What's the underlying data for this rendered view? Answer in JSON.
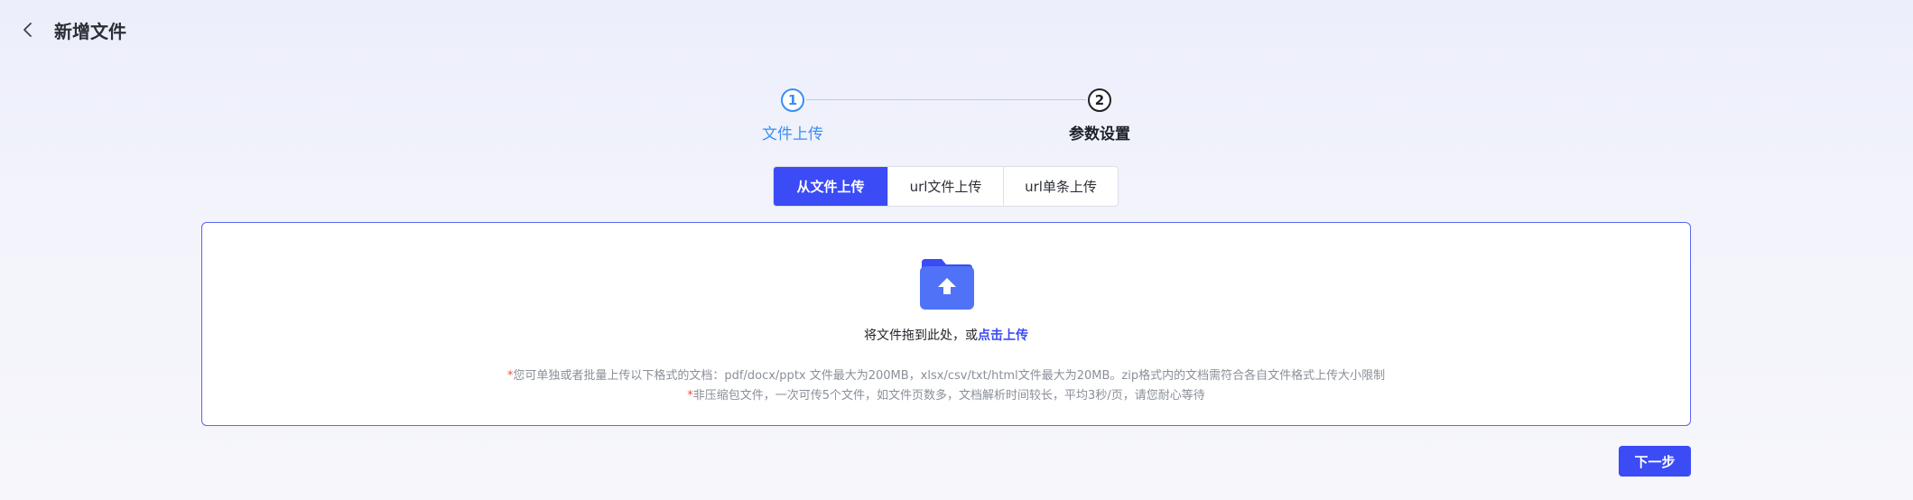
{
  "header": {
    "title": "新增文件",
    "back_icon": "chevron-left-icon"
  },
  "steps": [
    {
      "number": "1",
      "label": "文件上传",
      "state": "active",
      "color": "#3a8ef6"
    },
    {
      "number": "2",
      "label": "参数设置",
      "state": "pending",
      "color": "#1f2329"
    }
  ],
  "tabs": [
    {
      "label": "从文件上传",
      "active": true
    },
    {
      "label": "url文件上传",
      "active": false
    },
    {
      "label": "url单条上传",
      "active": false
    }
  ],
  "upload": {
    "icon": "folder-upload-icon",
    "drag_text": "将文件拖到此处，或",
    "click_text": "点击上传",
    "hint_star": "*",
    "hint_1": "您可单独或者批量上传以下格式的文档：pdf/docx/pptx 文件最大为200MB，xlsx/csv/txt/html文件最大为20MB。zip格式内的文档需符合各自文件格式上传大小限制",
    "hint_2": "非压缩包文件，一次可传5个文件，如文件页数多，文档解析时间较长，平均3秒/页，请您耐心等待"
  },
  "footer": {
    "next_label": "下一步"
  },
  "colors": {
    "accent": "#3b4bf5",
    "step_active": "#3a8ef6",
    "hint_star": "#e8553f"
  }
}
